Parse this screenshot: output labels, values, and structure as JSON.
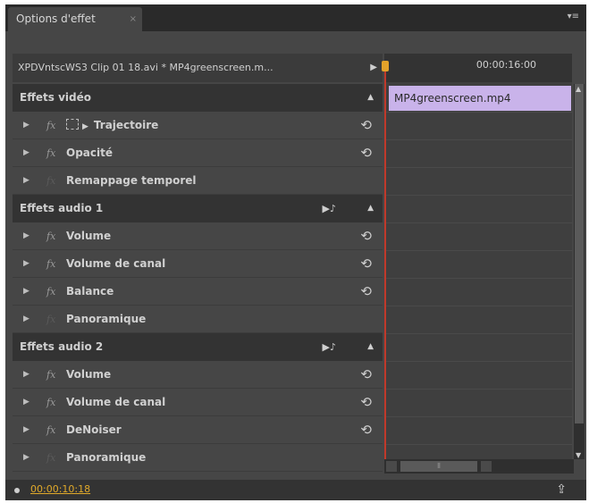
{
  "tab": {
    "title": "Options d'effet",
    "close": "×",
    "menu_icon": "panel-menu-icon",
    "menu_glyph": "▾≡"
  },
  "clip_row": {
    "label": "XPDVntscWS3 Clip 01 18.avi * MP4greenscreen.m...",
    "arrow": "▶"
  },
  "timeline": {
    "timecode": "00:00:16:00",
    "clip_name": "MP4greenscreen.mp4"
  },
  "sections": [
    {
      "title": "Effets vidéo",
      "items": [
        {
          "label": "Trajectoire",
          "reset": "⟲"
        },
        {
          "label": "Opacité",
          "reset": "⟲"
        },
        {
          "label": "Remappage temporel",
          "reset": ""
        }
      ]
    },
    {
      "title": "Effets audio 1",
      "items": [
        {
          "label": "Volume",
          "reset": "⟲"
        },
        {
          "label": "Volume de canal",
          "reset": "⟲"
        },
        {
          "label": "Balance",
          "reset": "⟲"
        },
        {
          "label": "Panoramique",
          "reset": ""
        }
      ]
    },
    {
      "title": "Effets audio 2",
      "items": [
        {
          "label": "Volume",
          "reset": "⟲"
        },
        {
          "label": "Volume de canal",
          "reset": "⟲"
        },
        {
          "label": "DeNoiser",
          "reset": "⟲"
        },
        {
          "label": "Panoramique",
          "reset": ""
        }
      ]
    }
  ],
  "glyphs": {
    "expand": "▶",
    "collapse": "▲",
    "fx": "fx",
    "audio": "▶♪"
  },
  "footer": {
    "current_time": "00:00:10:18",
    "export_icon": "export-icon",
    "export_glyph": "⇪"
  },
  "colors": {
    "panel_bg": "#464646",
    "timecode": "#e0a92a",
    "clip_bar": "#c9b3ea",
    "playhead": "#c0392b"
  }
}
